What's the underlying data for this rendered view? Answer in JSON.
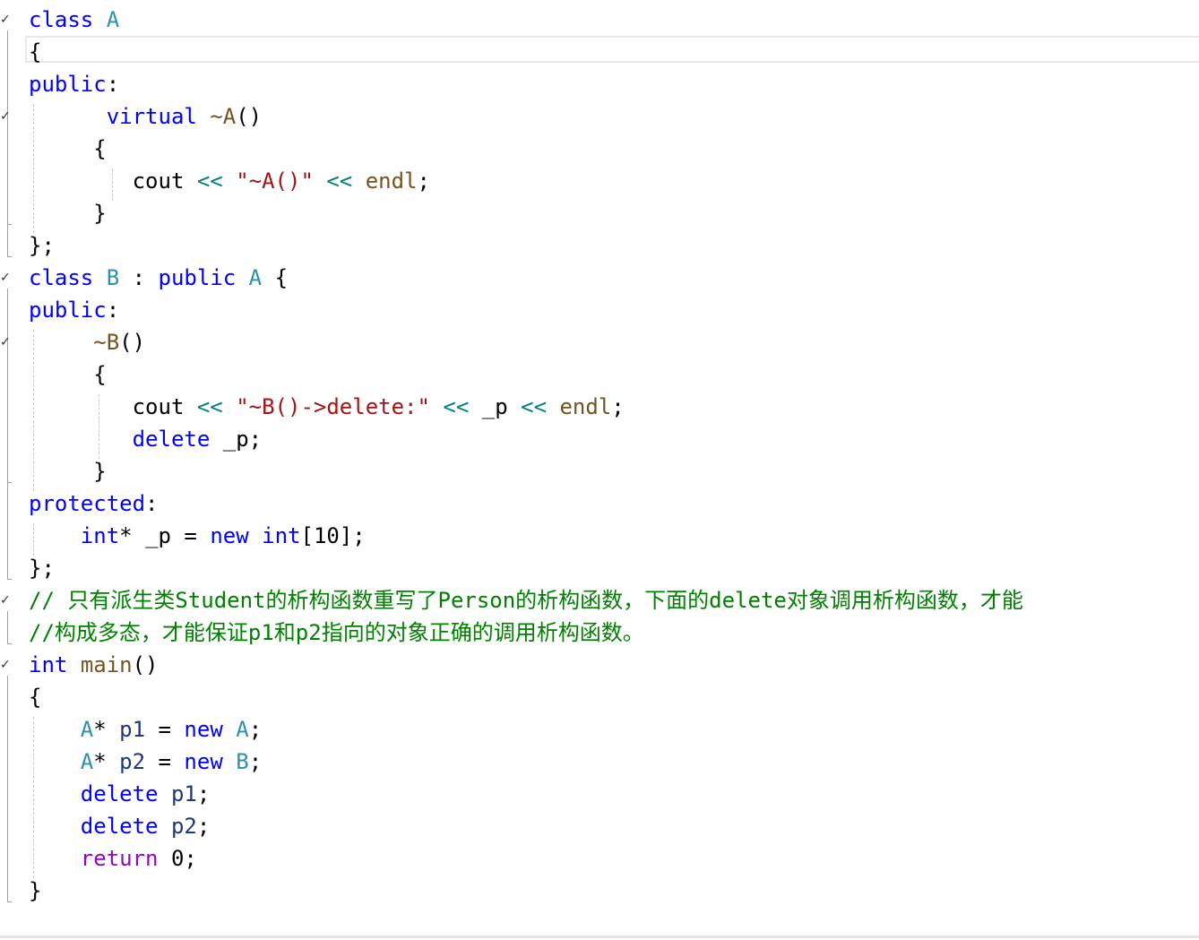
{
  "editor": {
    "lines": [
      {
        "tokens": [
          {
            "t": "class",
            "c": "kw"
          },
          {
            "t": " ",
            "c": "default"
          },
          {
            "t": "A",
            "c": "typ"
          }
        ]
      },
      {
        "tokens": [
          {
            "t": "{",
            "c": "punc"
          }
        ]
      },
      {
        "tokens": [
          {
            "t": "public",
            "c": "kw"
          },
          {
            "t": ":",
            "c": "punc"
          }
        ]
      },
      {
        "tokens": [
          {
            "t": "      ",
            "c": "default"
          },
          {
            "t": "virtual",
            "c": "kw"
          },
          {
            "t": " ",
            "c": "default"
          },
          {
            "t": "~A",
            "c": "fn"
          },
          {
            "t": "()",
            "c": "punc"
          }
        ]
      },
      {
        "tokens": [
          {
            "t": "     ",
            "c": "default"
          },
          {
            "t": "{",
            "c": "punc"
          }
        ]
      },
      {
        "tokens": [
          {
            "t": "        ",
            "c": "default"
          },
          {
            "t": "cout",
            "c": "default"
          },
          {
            "t": " ",
            "c": "default"
          },
          {
            "t": "<<",
            "c": "op"
          },
          {
            "t": " ",
            "c": "default"
          },
          {
            "t": "\"~A()\"",
            "c": "str"
          },
          {
            "t": " ",
            "c": "default"
          },
          {
            "t": "<<",
            "c": "op"
          },
          {
            "t": " ",
            "c": "default"
          },
          {
            "t": "endl",
            "c": "fn"
          },
          {
            "t": ";",
            "c": "punc"
          }
        ]
      },
      {
        "tokens": [
          {
            "t": "     ",
            "c": "default"
          },
          {
            "t": "}",
            "c": "punc"
          }
        ]
      },
      {
        "tokens": [
          {
            "t": "};",
            "c": "punc"
          }
        ]
      },
      {
        "tokens": [
          {
            "t": "class",
            "c": "kw"
          },
          {
            "t": " ",
            "c": "default"
          },
          {
            "t": "B",
            "c": "typ"
          },
          {
            "t": " : ",
            "c": "punc"
          },
          {
            "t": "public",
            "c": "kw"
          },
          {
            "t": " ",
            "c": "default"
          },
          {
            "t": "A",
            "c": "typ"
          },
          {
            "t": " {",
            "c": "punc"
          }
        ]
      },
      {
        "tokens": [
          {
            "t": "public",
            "c": "kw"
          },
          {
            "t": ":",
            "c": "punc"
          }
        ]
      },
      {
        "tokens": [
          {
            "t": "     ",
            "c": "default"
          },
          {
            "t": "~B",
            "c": "fn"
          },
          {
            "t": "()",
            "c": "punc"
          }
        ]
      },
      {
        "tokens": [
          {
            "t": "     ",
            "c": "default"
          },
          {
            "t": "{",
            "c": "punc"
          }
        ]
      },
      {
        "tokens": [
          {
            "t": "        ",
            "c": "default"
          },
          {
            "t": "cout",
            "c": "default"
          },
          {
            "t": " ",
            "c": "default"
          },
          {
            "t": "<<",
            "c": "op"
          },
          {
            "t": " ",
            "c": "default"
          },
          {
            "t": "\"~B()->delete:\"",
            "c": "str"
          },
          {
            "t": " ",
            "c": "default"
          },
          {
            "t": "<<",
            "c": "op"
          },
          {
            "t": " ",
            "c": "default"
          },
          {
            "t": "_p",
            "c": "default"
          },
          {
            "t": " ",
            "c": "default"
          },
          {
            "t": "<<",
            "c": "op"
          },
          {
            "t": " ",
            "c": "default"
          },
          {
            "t": "endl",
            "c": "fn"
          },
          {
            "t": ";",
            "c": "punc"
          }
        ]
      },
      {
        "tokens": [
          {
            "t": "        ",
            "c": "default"
          },
          {
            "t": "delete",
            "c": "kw"
          },
          {
            "t": " ",
            "c": "default"
          },
          {
            "t": "_p",
            "c": "default"
          },
          {
            "t": ";",
            "c": "punc"
          }
        ]
      },
      {
        "tokens": [
          {
            "t": "     ",
            "c": "default"
          },
          {
            "t": "}",
            "c": "punc"
          }
        ]
      },
      {
        "tokens": [
          {
            "t": "protected",
            "c": "kw"
          },
          {
            "t": ":",
            "c": "punc"
          }
        ]
      },
      {
        "tokens": [
          {
            "t": "    ",
            "c": "default"
          },
          {
            "t": "int",
            "c": "kw"
          },
          {
            "t": "* ",
            "c": "punc"
          },
          {
            "t": "_p",
            "c": "default"
          },
          {
            "t": " = ",
            "c": "punc"
          },
          {
            "t": "new",
            "c": "kw"
          },
          {
            "t": " ",
            "c": "default"
          },
          {
            "t": "int",
            "c": "kw"
          },
          {
            "t": "[10];",
            "c": "punc"
          }
        ]
      },
      {
        "tokens": [
          {
            "t": "};",
            "c": "punc"
          }
        ]
      },
      {
        "tokens": [
          {
            "t": "// 只有派生类Student的析构函数重写了Person的析构函数，下面的delete对象调用析构函数，才能",
            "c": "cmt"
          }
        ]
      },
      {
        "tokens": [
          {
            "t": "//构成多态，才能保证p1和p2指向的对象正确的调用析构函数。",
            "c": "cmt"
          }
        ]
      },
      {
        "tokens": [
          {
            "t": "int",
            "c": "kw"
          },
          {
            "t": " ",
            "c": "default"
          },
          {
            "t": "main",
            "c": "fn"
          },
          {
            "t": "()",
            "c": "punc"
          }
        ]
      },
      {
        "tokens": [
          {
            "t": "{",
            "c": "punc"
          }
        ]
      },
      {
        "tokens": [
          {
            "t": "    ",
            "c": "default"
          },
          {
            "t": "A",
            "c": "typ"
          },
          {
            "t": "* ",
            "c": "punc"
          },
          {
            "t": "p1",
            "c": "var"
          },
          {
            "t": " = ",
            "c": "punc"
          },
          {
            "t": "new",
            "c": "kw"
          },
          {
            "t": " ",
            "c": "default"
          },
          {
            "t": "A",
            "c": "typ"
          },
          {
            "t": ";",
            "c": "punc"
          }
        ]
      },
      {
        "tokens": [
          {
            "t": "    ",
            "c": "default"
          },
          {
            "t": "A",
            "c": "typ"
          },
          {
            "t": "* ",
            "c": "punc"
          },
          {
            "t": "p2",
            "c": "var"
          },
          {
            "t": " = ",
            "c": "punc"
          },
          {
            "t": "new",
            "c": "kw"
          },
          {
            "t": " ",
            "c": "default"
          },
          {
            "t": "B",
            "c": "typ"
          },
          {
            "t": ";",
            "c": "punc"
          }
        ]
      },
      {
        "tokens": [
          {
            "t": "    ",
            "c": "default"
          },
          {
            "t": "delete",
            "c": "kw"
          },
          {
            "t": " ",
            "c": "default"
          },
          {
            "t": "p1",
            "c": "var"
          },
          {
            "t": ";",
            "c": "punc"
          }
        ]
      },
      {
        "tokens": [
          {
            "t": "    ",
            "c": "default"
          },
          {
            "t": "delete",
            "c": "kw"
          },
          {
            "t": " ",
            "c": "default"
          },
          {
            "t": "p2",
            "c": "var"
          },
          {
            "t": ";",
            "c": "punc"
          }
        ]
      },
      {
        "tokens": [
          {
            "t": "    ",
            "c": "default"
          },
          {
            "t": "return",
            "c": "kw2"
          },
          {
            "t": " 0;",
            "c": "punc"
          }
        ]
      },
      {
        "tokens": [
          {
            "t": "}",
            "c": "punc"
          }
        ]
      }
    ],
    "fold_marker_icon": "collapse-chevron-icon",
    "current_line": 2
  }
}
